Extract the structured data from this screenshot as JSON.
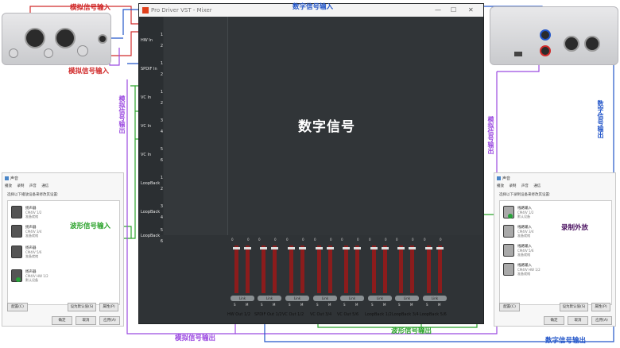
{
  "mixer": {
    "title": "Pro Driver VST - Mixer",
    "center_label": "数字信号",
    "inputs": [
      {
        "name": "HW In",
        "a": "1",
        "b": "2"
      },
      {
        "name": "SPDIF In",
        "a": "1",
        "b": "2"
      },
      {
        "name": "VC In",
        "a": "1",
        "b": "2"
      },
      {
        "name": "VC In",
        "a": "3",
        "b": "4"
      },
      {
        "name": "VC In",
        "a": "5",
        "b": "6"
      },
      {
        "name": "LoopBack",
        "a": "1",
        "b": "2"
      },
      {
        "name": "LoopBack",
        "a": "3",
        "b": "4"
      },
      {
        "name": "LoopBack",
        "a": "5",
        "b": "6"
      }
    ],
    "outputs": [
      "HW Out 1/2",
      "SPDIF Out 1/2",
      "VC Out 1/2",
      "VC Out 3/4",
      "VC Out 5/6",
      "LoopBack 1/2",
      "LoopBack 3/4",
      "LoopBack 5/6"
    ],
    "link_label": "Link",
    "solo_label": "S",
    "mute_label": "M",
    "meter_value": "0"
  },
  "annotations": {
    "analog_in_top": "模拟信号输入",
    "analog_in_bottom": "模拟信号输入",
    "digital_in": "数字信号输入",
    "analog_out_left": "模拟信号输出",
    "analog_out_right": "模拟信号输出",
    "digital_out_right": "数字信号输出",
    "waveform_in": "波形信号输入",
    "waveform_out": "波形信号输出",
    "analog_out_bottom": "模拟信号输出",
    "digital_out_bottom": "数字信号输出",
    "record_loopback": "录制外放"
  },
  "playback_dialog": {
    "title": "声音",
    "tabs": [
      "播放",
      "录制",
      "声音",
      "通信"
    ],
    "desc": "选择以下播放设备来修改其设置:",
    "devices": [
      {
        "name": "扬声器",
        "sub": "CM4IV 1/2",
        "status": "准备就绪"
      },
      {
        "name": "扬声器",
        "sub": "CM4IV 3/4",
        "status": "准备就绪"
      },
      {
        "name": "扬声器",
        "sub": "CM4IV 5/6",
        "status": "准备就绪"
      },
      {
        "name": "扬声器",
        "sub": "CM4IV HW 1/2",
        "status": "默认设备"
      }
    ],
    "configure_btn": "配置(C)",
    "set_default_btn": "设为默认值(S)",
    "properties_btn": "属性(P)",
    "ok_btn": "确定",
    "cancel_btn": "取消",
    "apply_btn": "应用(A)"
  },
  "recording_dialog": {
    "title": "声音",
    "tabs": [
      "播放",
      "录制",
      "声音",
      "通信"
    ],
    "desc": "选择以下录制设备来修改其设置:",
    "devices": [
      {
        "name": "线路输入",
        "sub": "CM4IV 1/2",
        "status": "默认设备"
      },
      {
        "name": "线路输入",
        "sub": "CM4IV 3/4",
        "status": "准备就绪"
      },
      {
        "name": "线路输入",
        "sub": "CM4IV 5/6",
        "status": "准备就绪"
      },
      {
        "name": "线路输入",
        "sub": "CM4IV HW 1/2",
        "status": "准备就绪"
      }
    ],
    "configure_btn": "配置(C)",
    "set_default_btn": "设为默认值(S)",
    "properties_btn": "属性(P)",
    "ok_btn": "确定",
    "cancel_btn": "取消",
    "apply_btn": "应用(A)"
  },
  "colors": {
    "analog": "#d12b2b",
    "digital": "#2356c9",
    "output": "#9b4ae0",
    "waveform": "#2ba32b"
  }
}
